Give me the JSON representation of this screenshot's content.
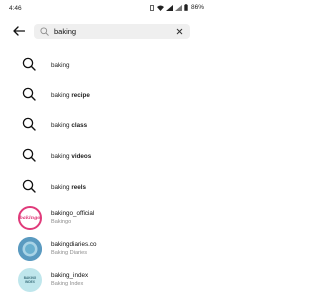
{
  "status_bar": {
    "time": "4:46",
    "battery": "86%"
  },
  "search": {
    "query": "baking"
  },
  "suggestions": [
    {
      "prefix": "baking",
      "suffix": ""
    },
    {
      "prefix": "baking ",
      "suffix": "recipe"
    },
    {
      "prefix": "baking ",
      "suffix": "class"
    },
    {
      "prefix": "baking ",
      "suffix": "videos"
    },
    {
      "prefix": "baking ",
      "suffix": "reels"
    }
  ],
  "accounts": [
    {
      "username": "bakingo_official",
      "name": "Bakingo",
      "avatar_text": "bakingo",
      "avatar_color": "#e03a7a"
    },
    {
      "username": "bakingdiaries.co",
      "name": "Baking Diaries",
      "avatar_text": "",
      "avatar_color": "#4a8fb8"
    },
    {
      "username": "baking_index",
      "name": "Baking Index",
      "avatar_text": "BAKING INDEX",
      "avatar_color": "#bfe6ec"
    }
  ],
  "colors": {
    "search_bg": "#efefef",
    "muted_text": "#8e8e8e"
  }
}
